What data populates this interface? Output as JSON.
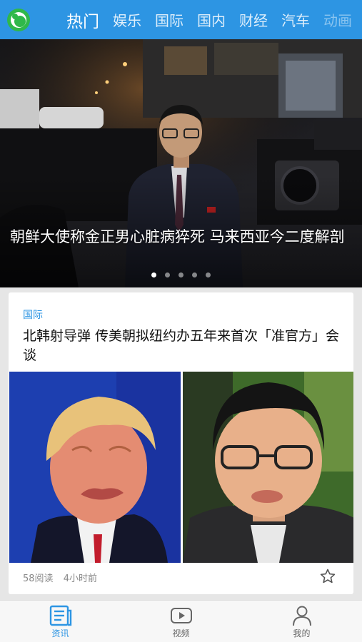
{
  "header": {
    "tabs": [
      {
        "label": "热门",
        "active": true
      },
      {
        "label": "娱乐"
      },
      {
        "label": "国际"
      },
      {
        "label": "国内"
      },
      {
        "label": "财经"
      },
      {
        "label": "汽车"
      },
      {
        "label": "动画"
      }
    ],
    "brand_color": "#2d95e3"
  },
  "hero": {
    "title": "朝鲜大使称金正男心脏病猝死 马来西亚今二度解剖",
    "slide_count": 5,
    "active_slide": 1
  },
  "article": {
    "category": "国际",
    "title": "北韩射导弹 传美朝拟纽约办五年来首次「准官方」会谈",
    "reads": "58阅读",
    "time": "4小时前"
  },
  "bottom_nav": {
    "items": [
      {
        "label": "资讯",
        "icon": "news-icon",
        "active": true
      },
      {
        "label": "视频",
        "icon": "video-icon"
      },
      {
        "label": "我的",
        "icon": "profile-icon"
      }
    ]
  }
}
